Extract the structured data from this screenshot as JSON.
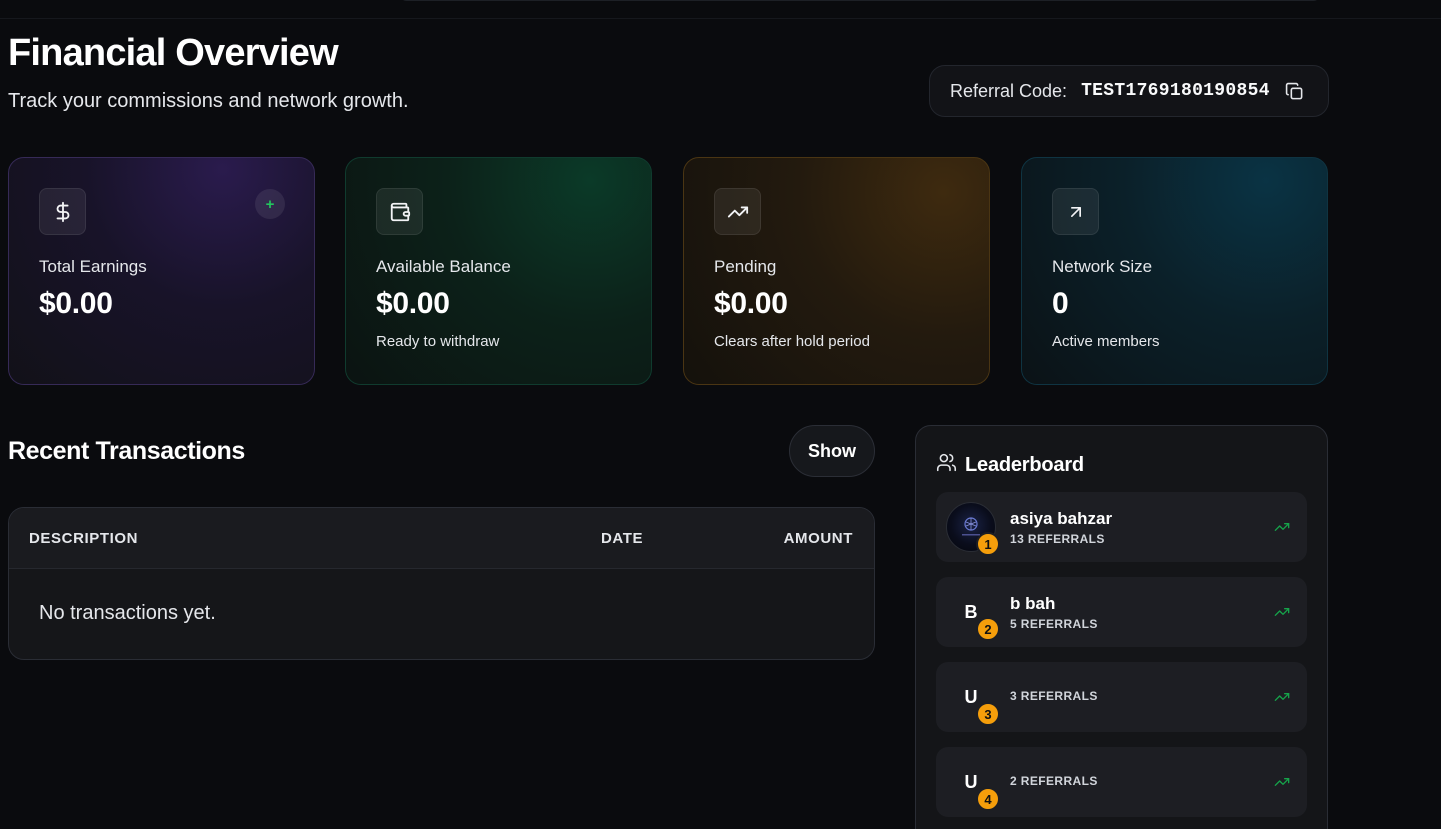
{
  "header": {
    "title": "Financial Overview",
    "subtitle": "Track your commissions and network growth."
  },
  "referral": {
    "label": "Referral Code:",
    "code": "TEST1769180190854",
    "copy_icon": "copy-icon"
  },
  "stats": [
    {
      "icon": "dollar-icon",
      "label": "Total Earnings",
      "value": "$0.00",
      "sub": ""
    },
    {
      "icon": "wallet-icon",
      "label": "Available Balance",
      "value": "$0.00",
      "sub": "Ready to withdraw"
    },
    {
      "icon": "trending-up-icon",
      "label": "Pending",
      "value": "$0.00",
      "sub": "Clears after hold period"
    },
    {
      "icon": "arrow-up-right-icon",
      "label": "Network Size",
      "value": "0",
      "sub": "Active members"
    }
  ],
  "stats_plus": "+",
  "transactions": {
    "title": "Recent Transactions",
    "show_label": "Show",
    "columns": [
      "DESCRIPTION",
      "DATE",
      "AMOUNT"
    ],
    "empty_text": "No transactions yet."
  },
  "leaderboard": {
    "title": "Leaderboard",
    "icon": "users-icon",
    "entries": [
      {
        "rank": "1",
        "avatar": "",
        "name": "asiya bahzar",
        "referrals": "13 REFERRALS"
      },
      {
        "rank": "2",
        "avatar": "B",
        "name": "b bah",
        "referrals": "5 REFERRALS"
      },
      {
        "rank": "3",
        "avatar": "U",
        "name": "",
        "referrals": "3 REFERRALS"
      },
      {
        "rank": "4",
        "avatar": "U",
        "name": "",
        "referrals": "2 REFERRALS"
      }
    ]
  },
  "colors": {
    "background": "#0a0b0e",
    "rank_badge": "#f59e0b",
    "trend_green": "#16a34a",
    "plus_green": "#22c55e"
  }
}
